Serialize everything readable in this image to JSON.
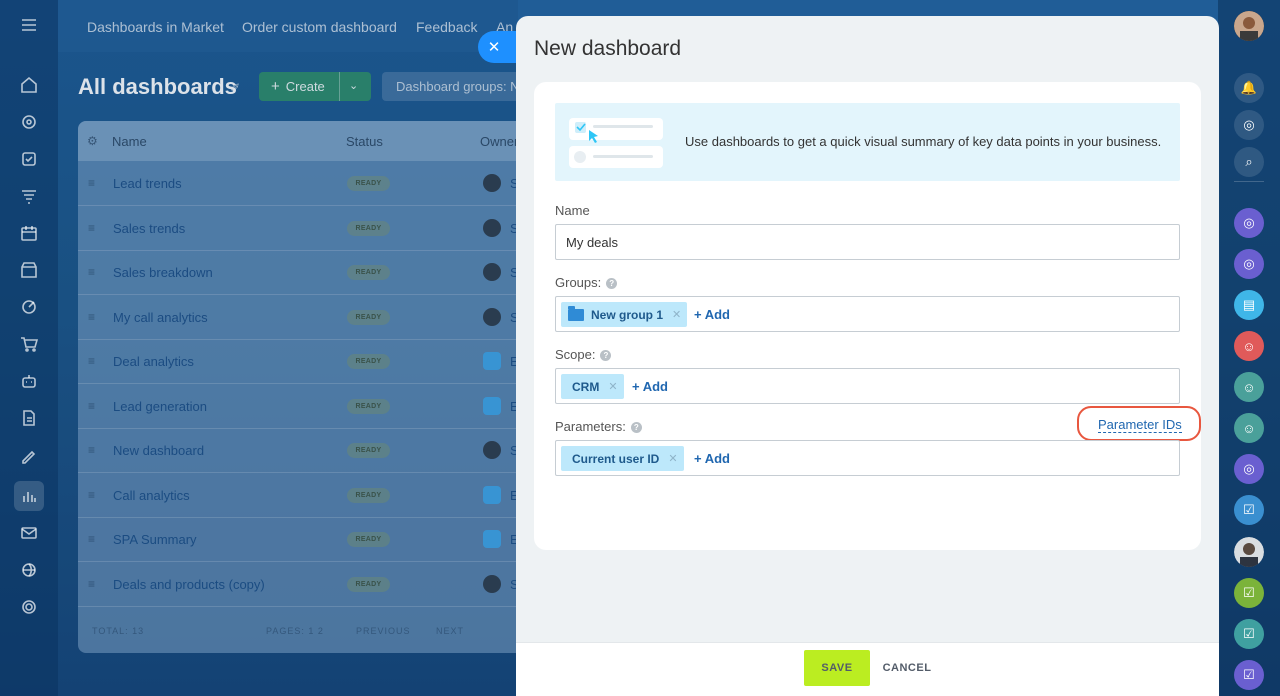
{
  "topnav": {
    "items": [
      "Dashboards in Market",
      "Order custom dashboard",
      "Feedback",
      "An"
    ]
  },
  "page": {
    "title": "All dashboards",
    "create_label": "Create",
    "groups_filter": "Dashboard groups: N"
  },
  "table": {
    "columns": [
      "Name",
      "Status",
      "Owner"
    ],
    "rows": [
      {
        "name": "Lead trends",
        "status": "READY",
        "owner": "S"
      },
      {
        "name": "Sales trends",
        "status": "READY",
        "owner": "S"
      },
      {
        "name": "Sales breakdown",
        "status": "READY",
        "owner": "S"
      },
      {
        "name": "My call analytics",
        "status": "READY",
        "owner": "S"
      },
      {
        "name": "Deal analytics",
        "status": "READY",
        "owner": "E"
      },
      {
        "name": "Lead generation",
        "status": "READY",
        "owner": "E"
      },
      {
        "name": "New dashboard",
        "status": "READY",
        "owner": "S"
      },
      {
        "name": "Call analytics",
        "status": "READY",
        "owner": "E"
      },
      {
        "name": "SPA Summary",
        "status": "READY",
        "owner": "E"
      },
      {
        "name": "Deals and products (copy)",
        "status": "READY",
        "owner": "S"
      }
    ],
    "footer": {
      "total": "TOTAL: 13",
      "pages": "PAGES: 1  2",
      "previous": "PREVIOUS",
      "next": "NEXT"
    }
  },
  "slider": {
    "title": "New dashboard",
    "close_icon": "close-icon",
    "info_text": "Use dashboards to get a quick visual summary of key data points in your business.",
    "name_field": {
      "label": "Name",
      "value": "My deals"
    },
    "groups_field": {
      "label": "Groups:",
      "tags": [
        "New group 1"
      ],
      "add_label": "+ Add"
    },
    "scope_field": {
      "label": "Scope:",
      "tags": [
        "CRM"
      ],
      "add_label": "+ Add"
    },
    "parameters_field": {
      "label": "Parameters:",
      "tags": [
        "Current user ID"
      ],
      "add_label": "+ Add",
      "link_label": "Parameter IDs"
    },
    "save_label": "SAVE",
    "cancel_label": "CANCEL"
  },
  "colors": {
    "accent": "#1e90ff",
    "save_button": "#bbed21",
    "tag": "#bde8fb",
    "highlight": "#e8573f",
    "link": "#2067b0"
  }
}
